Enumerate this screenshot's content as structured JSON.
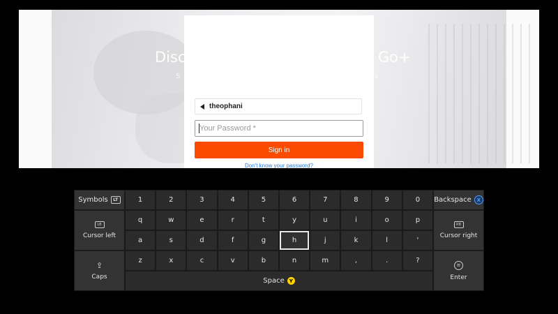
{
  "page": {
    "bg_heading_left": "Disc",
    "bg_heading_right": "Go+",
    "bg_sub_left": "S",
    "bg_sub_right": "s"
  },
  "login": {
    "username": "theophani",
    "password_placeholder": "Your Password *",
    "signin_label": "Sign in",
    "forgot_label": "Don't know your password?"
  },
  "keyboard": {
    "symbols_label": "Symbols",
    "symbols_badge": "LT",
    "backspace_label": "Backspace",
    "backspace_badge": "X",
    "cursor_left_label": "Cursor left",
    "cursor_left_badge": "LB",
    "cursor_right_label": "Cursor right",
    "cursor_right_badge": "RB",
    "caps_label": "Caps",
    "enter_label": "Enter",
    "space_label": "Space",
    "space_badge": "Y",
    "row1": [
      "1",
      "2",
      "3",
      "4",
      "5",
      "6",
      "7",
      "8",
      "9",
      "0"
    ],
    "row2": [
      "q",
      "w",
      "e",
      "r",
      "t",
      "y",
      "u",
      "i",
      "o",
      "p"
    ],
    "row3": [
      "a",
      "s",
      "d",
      "f",
      "g",
      "h",
      "j",
      "k",
      "l",
      "'"
    ],
    "row4": [
      "z",
      "x",
      "c",
      "v",
      "b",
      "n",
      "m",
      ",",
      ".",
      "?"
    ],
    "focused_key": "h",
    "accent_color": "#fa4b00"
  }
}
